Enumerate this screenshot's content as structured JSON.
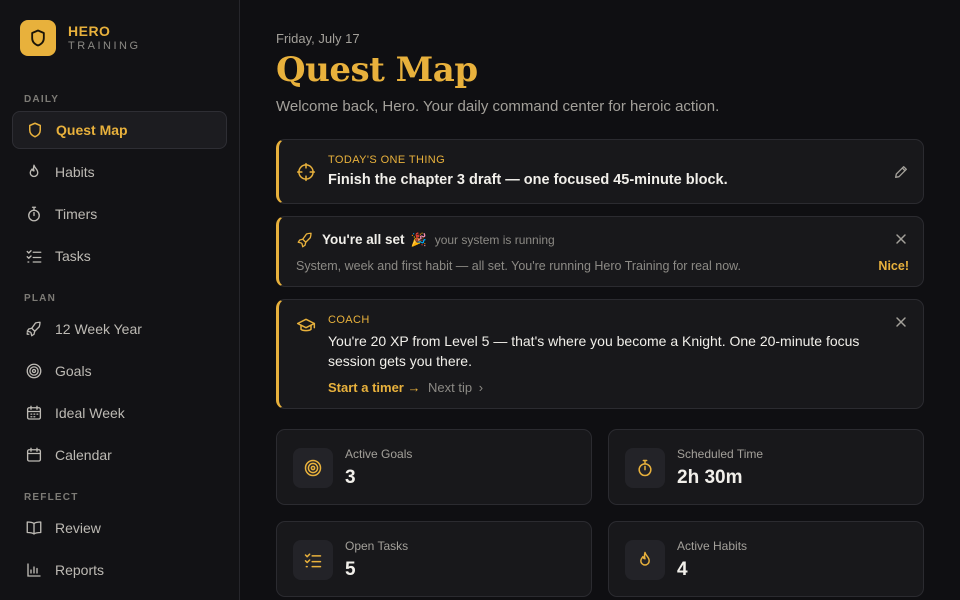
{
  "brand": {
    "name": "HERO",
    "sub": "TRAINING"
  },
  "sidebar": {
    "sections": [
      {
        "label": "DAILY",
        "items": [
          {
            "label": "Quest Map",
            "icon": "shield-icon",
            "active": true
          },
          {
            "label": "Habits",
            "icon": "flame-icon"
          },
          {
            "label": "Timers",
            "icon": "stopwatch-icon"
          },
          {
            "label": "Tasks",
            "icon": "checklist-icon"
          }
        ]
      },
      {
        "label": "PLAN",
        "items": [
          {
            "label": "12 Week Year",
            "icon": "rocket-icon"
          },
          {
            "label": "Goals",
            "icon": "target-icon"
          },
          {
            "label": "Ideal Week",
            "icon": "calendar-grid-icon"
          },
          {
            "label": "Calendar",
            "icon": "calendar-icon"
          }
        ]
      },
      {
        "label": "REFLECT",
        "items": [
          {
            "label": "Review",
            "icon": "book-icon"
          },
          {
            "label": "Reports",
            "icon": "bar-chart-icon"
          }
        ]
      }
    ]
  },
  "header": {
    "date": "Friday, July 17",
    "title": "Quest Map",
    "subtitle": "Welcome back, Hero. Your daily command center for heroic action."
  },
  "one_thing": {
    "eyebrow": "TODAY'S ONE THING",
    "text": "Finish the chapter 3 draft — one focused 45-minute block."
  },
  "all_set": {
    "title": "You're all set",
    "emoji": "🎉",
    "status": "your system is running",
    "body": "System, week and first habit — all set. You're running Hero Training for real now.",
    "action": "Nice!"
  },
  "coach": {
    "eyebrow": "COACH",
    "line1": "You're 20 XP from Level 5 — that's where you become a Knight. One 20-minute focus",
    "line2": "session gets you there.",
    "primary": "Start a timer →",
    "secondary": "Next tip",
    "secondary_chevron": "›"
  },
  "stats": [
    {
      "label": "Active Goals",
      "value": "3",
      "icon": "target-icon"
    },
    {
      "label": "Scheduled Time",
      "value": "2h 30m",
      "icon": "stopwatch-icon"
    },
    {
      "label": "Open Tasks",
      "value": "5",
      "icon": "checklist-icon"
    },
    {
      "label": "Active Habits",
      "value": "4",
      "icon": "flame-icon"
    }
  ],
  "colors": {
    "accent": "#e8b13c",
    "background": "#0f0f12",
    "card": "#18181b",
    "muted": "#a3a09a"
  }
}
